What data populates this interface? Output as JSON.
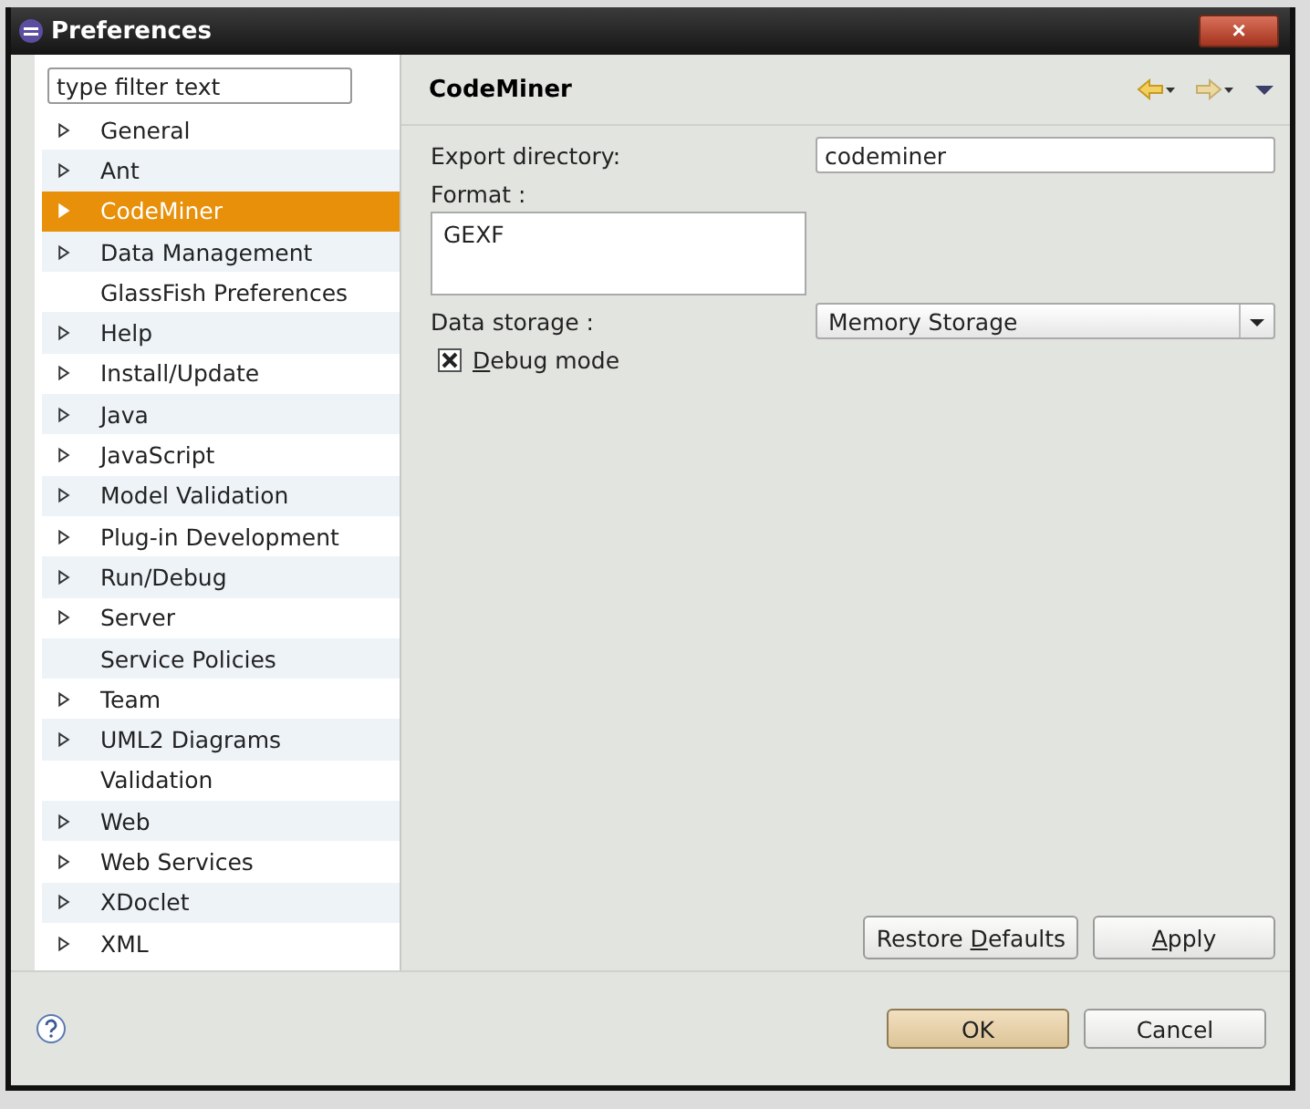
{
  "window": {
    "title": "Preferences",
    "close": "×"
  },
  "filter": {
    "placeholder": "type filter text"
  },
  "tree": [
    {
      "label": "General",
      "expandable": true,
      "selected": false
    },
    {
      "label": "Ant",
      "expandable": true,
      "selected": false
    },
    {
      "label": "CodeMiner",
      "expandable": true,
      "selected": true
    },
    {
      "label": "Data Management",
      "expandable": true,
      "selected": false
    },
    {
      "label": "GlassFish Preferences",
      "expandable": false,
      "selected": false
    },
    {
      "label": "Help",
      "expandable": true,
      "selected": false
    },
    {
      "label": "Install/Update",
      "expandable": true,
      "selected": false
    },
    {
      "label": "Java",
      "expandable": true,
      "selected": false
    },
    {
      "label": "JavaScript",
      "expandable": true,
      "selected": false
    },
    {
      "label": "Model Validation",
      "expandable": true,
      "selected": false
    },
    {
      "label": "Plug-in Development",
      "expandable": true,
      "selected": false
    },
    {
      "label": "Run/Debug",
      "expandable": true,
      "selected": false
    },
    {
      "label": "Server",
      "expandable": true,
      "selected": false
    },
    {
      "label": "Service Policies",
      "expandable": false,
      "selected": false
    },
    {
      "label": "Team",
      "expandable": true,
      "selected": false
    },
    {
      "label": "UML2 Diagrams",
      "expandable": true,
      "selected": false
    },
    {
      "label": "Validation",
      "expandable": false,
      "selected": false
    },
    {
      "label": "Web",
      "expandable": true,
      "selected": false
    },
    {
      "label": "Web Services",
      "expandable": true,
      "selected": false
    },
    {
      "label": "XDoclet",
      "expandable": true,
      "selected": false
    },
    {
      "label": "XML",
      "expandable": true,
      "selected": false
    }
  ],
  "page": {
    "title": "CodeMiner",
    "export_directory": {
      "label": "Export directory:",
      "value": "codeminer"
    },
    "format": {
      "label": "Format :",
      "value": "GEXF"
    },
    "data_storage": {
      "label": "Data storage :",
      "value": "Memory Storage"
    },
    "debug_mode": {
      "key": "D",
      "after": "ebug mode",
      "checked": true
    }
  },
  "page_buttons": [
    {
      "before": "Restore ",
      "key": "D",
      "after": "efaults"
    },
    {
      "key": "A",
      "after": "pply"
    }
  ],
  "dialog_buttons": [
    {
      "label": "OK",
      "default": true
    },
    {
      "label": "Cancel",
      "default": false
    }
  ]
}
